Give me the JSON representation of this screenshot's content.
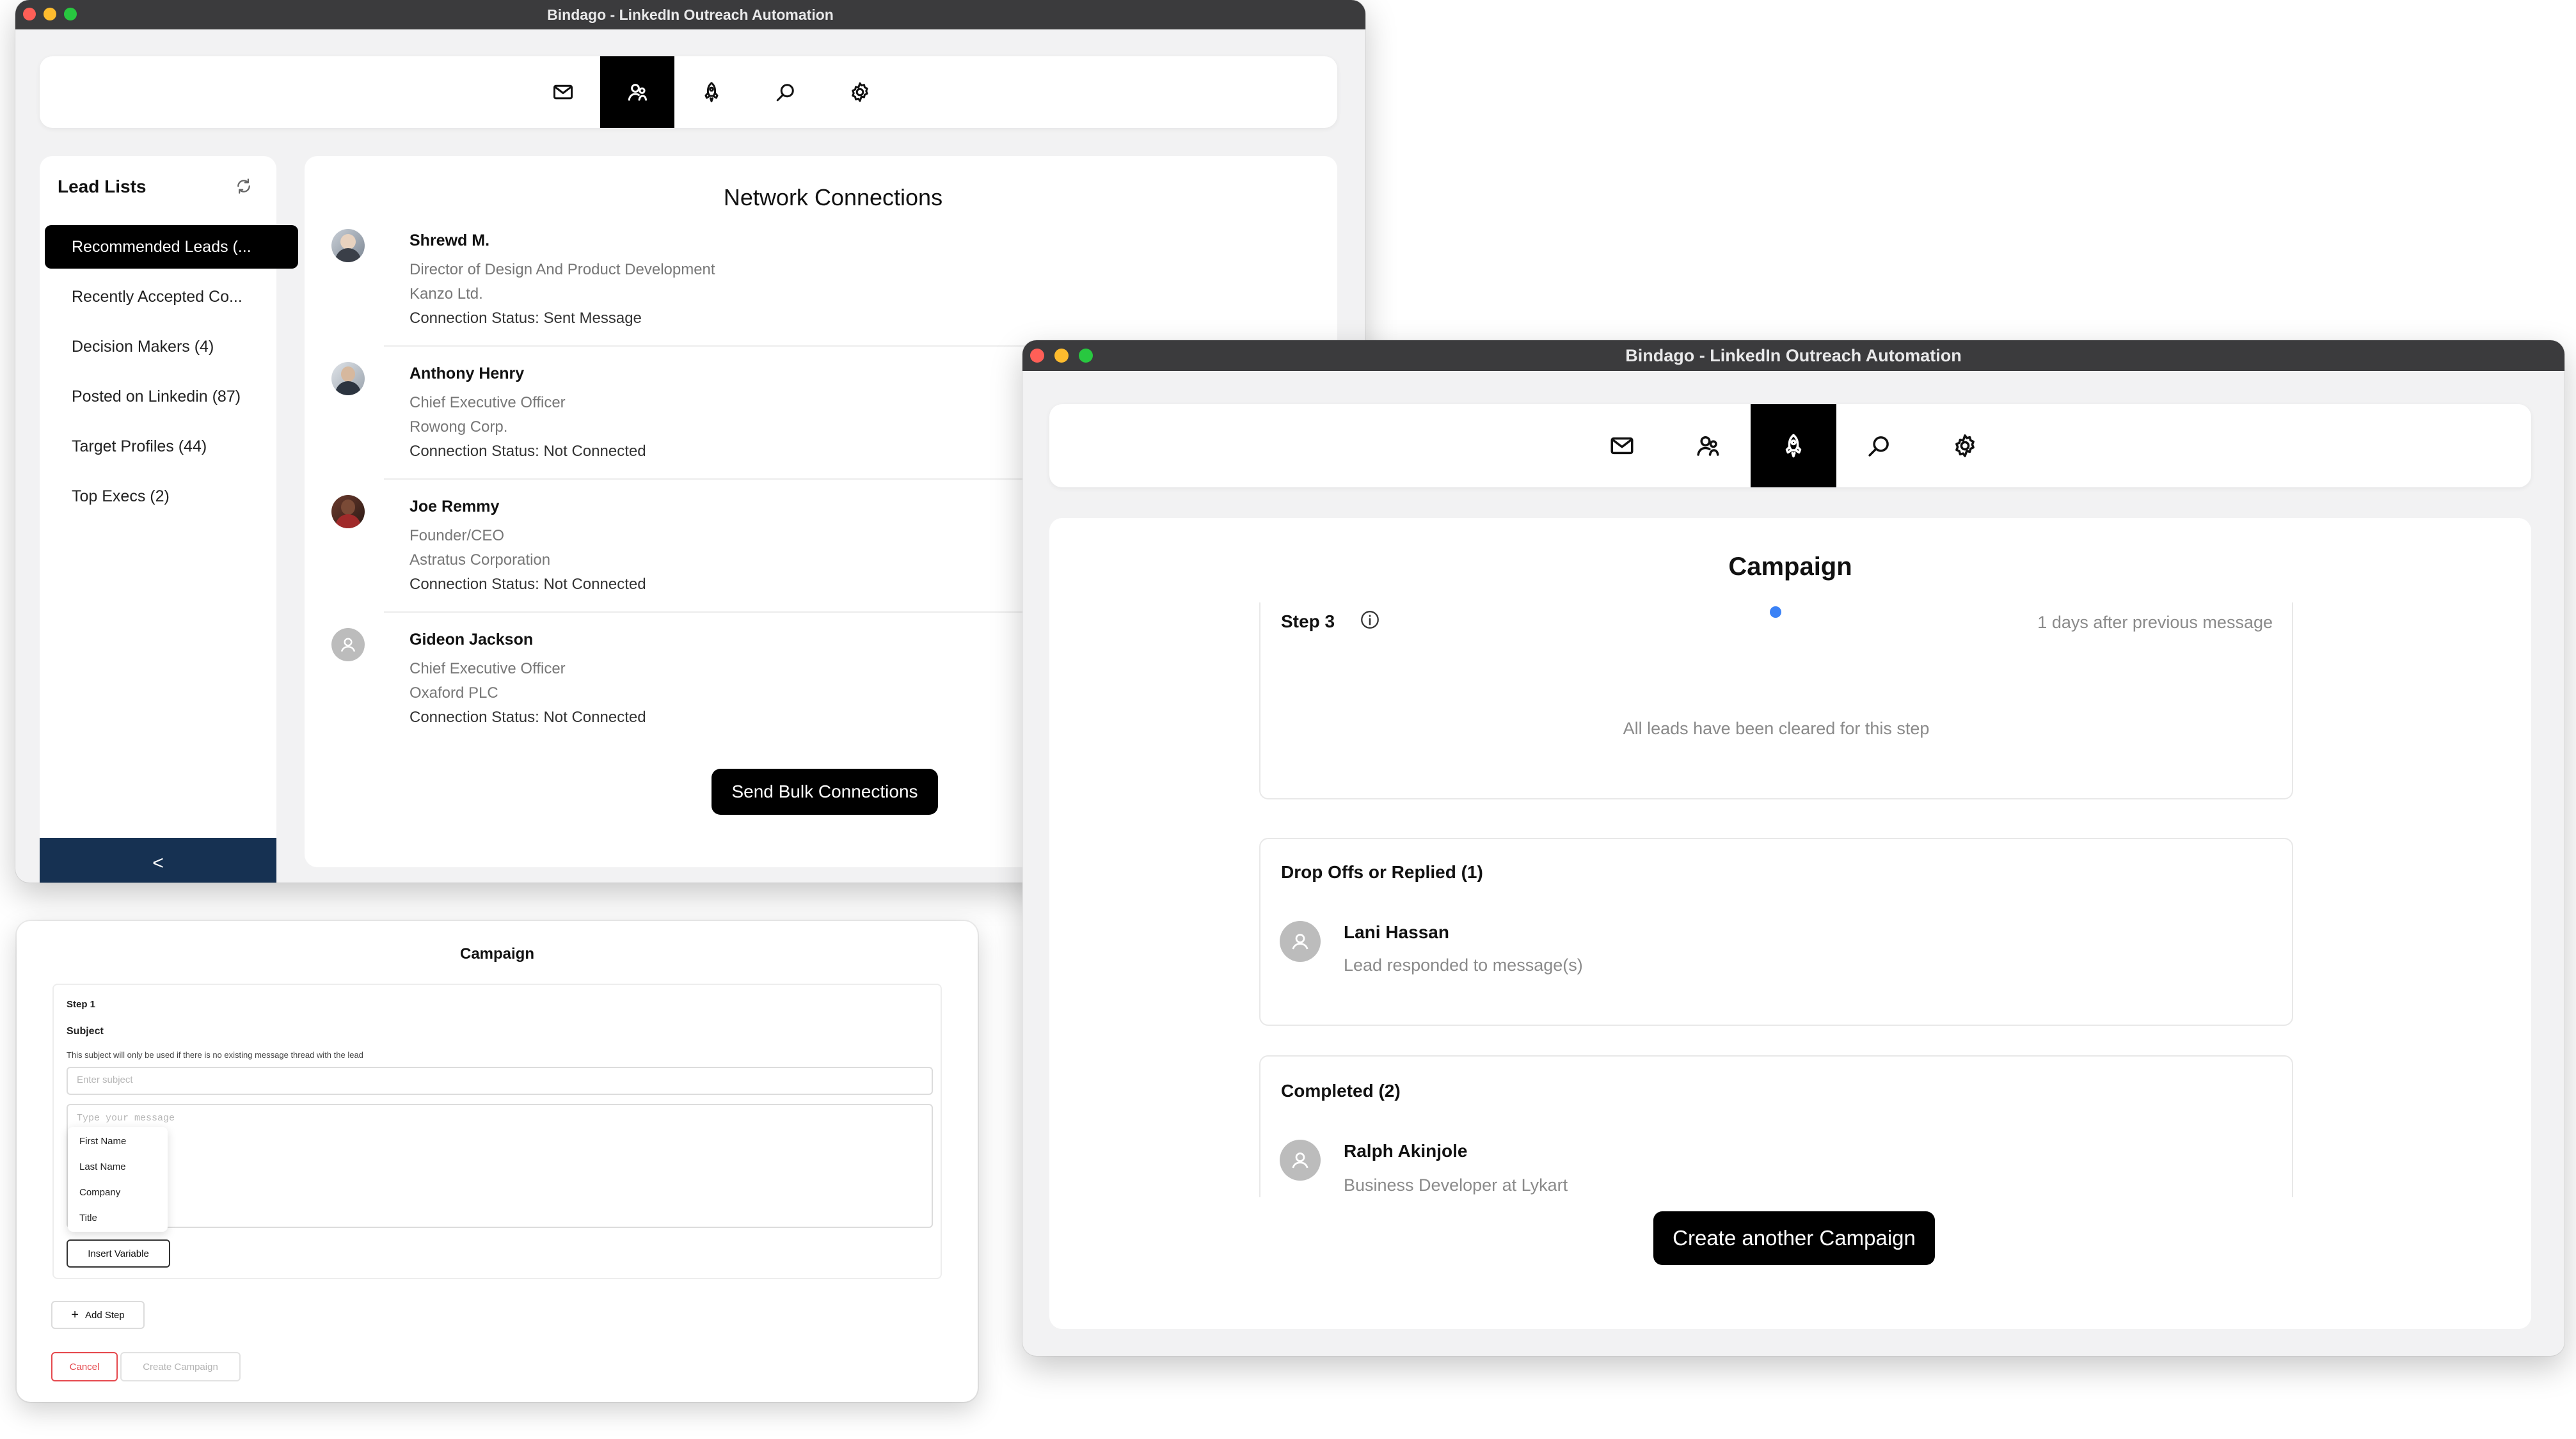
{
  "window_title": "Bindago - LinkedIn Outreach Automation",
  "nav_icons": [
    "mail-icon",
    "users-icon",
    "rocket-icon",
    "search-icon",
    "gear-icon"
  ],
  "colors": {
    "accent": "#000000",
    "sidebar_footer": "#163152",
    "progress_dot": "#3b82f6",
    "cancel": "#e5484d"
  },
  "leads_window": {
    "active_nav": "users-icon",
    "lead_lists": {
      "title": "Lead Lists",
      "items": [
        {
          "label": "Recommended Leads (...",
          "active": true
        },
        {
          "label": "Recently Accepted Co...",
          "active": false
        },
        {
          "label": "Decision Makers (4)",
          "active": false
        },
        {
          "label": "Posted on Linkedin (87)",
          "active": false
        },
        {
          "label": "Target Profiles (44)",
          "active": false
        },
        {
          "label": "Top Execs (2)",
          "active": false
        }
      ],
      "collapse_label": "<"
    },
    "network": {
      "title": "Network Connections",
      "connections": [
        {
          "name": "Shrewd M.",
          "title": "Director of Design And Product Development",
          "company": "Kanzo Ltd.",
          "status": "Connection Status: Sent Message"
        },
        {
          "name": "Anthony Henry",
          "title": "Chief Executive Officer",
          "company": "Rowong Corp.",
          "status": "Connection Status: Not Connected"
        },
        {
          "name": "Joe Remmy",
          "title": "Founder/CEO",
          "company": "Astratus Corporation",
          "status": "Connection Status: Not Connected"
        },
        {
          "name": "Gideon Jackson",
          "title": "Chief Executive Officer",
          "company": "Oxaford PLC",
          "status": "Connection Status: Not Connected"
        }
      ],
      "bulk_button": "Send Bulk Connections"
    }
  },
  "campaign_window": {
    "active_nav": "rocket-icon",
    "title": "Campaign",
    "step": {
      "label": "Step 3",
      "delay": "1 days after previous message",
      "empty_text": "All leads have been cleared for this step"
    },
    "dropoffs": {
      "title": "Drop Offs or Replied (1)",
      "name": "Lani Hassan",
      "note": "Lead responded to message(s)"
    },
    "completed": {
      "title": "Completed (2)",
      "name": "Ralph Akinjole",
      "note": "Business Developer at Lykart"
    },
    "create_button": "Create another Campaign"
  },
  "editor_window": {
    "title": "Campaign",
    "step_label": "Step 1",
    "subject_label": "Subject",
    "subject_hint": "This subject will only be used if there is no existing message thread with the lead",
    "subject_placeholder": "Enter subject",
    "message_placeholder": "Type your message",
    "variables": [
      "First Name",
      "Last Name",
      "Company",
      "Title"
    ],
    "insert_variable": "Insert Variable",
    "add_step": "Add Step",
    "cancel": "Cancel",
    "create": "Create Campaign"
  }
}
